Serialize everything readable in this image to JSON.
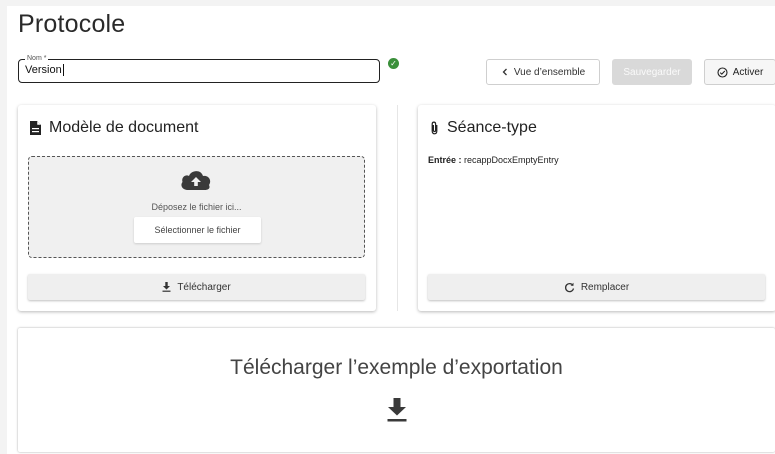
{
  "page": {
    "title": "Protocole"
  },
  "name_field": {
    "label": "Nom *",
    "value": "Version",
    "valid_icon": "check-circle-icon",
    "valid_color": "#3a8f3a"
  },
  "toolbar": {
    "overview_label": "Vue d’ensemble",
    "save_label": "Sauvegarder",
    "activate_label": "Activer"
  },
  "model_card": {
    "title": "Modèle de document",
    "drop_text": "Déposez le fichier ici...",
    "select_label": "Sélectionner le fichier",
    "download_label": "Télécharger"
  },
  "seance_card": {
    "title": "Séance-type",
    "entry_label": "Entrée :",
    "entry_value": "recappDocxEmptyEntry",
    "replace_label": "Remplacer"
  },
  "export_card": {
    "title": "Télécharger l’exemple d’exportation"
  },
  "icons": {
    "overview": "chevron-left-icon",
    "activate": "check-circle-outline-icon",
    "model": "document-icon",
    "seance": "paperclip-icon",
    "upload": "cloud-upload-icon",
    "download": "download-icon",
    "replace": "refresh-icon"
  }
}
